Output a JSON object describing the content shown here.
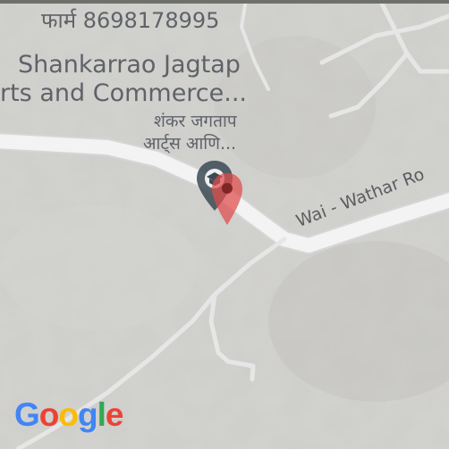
{
  "map": {
    "place_phone_label": "फार्म 8698178995",
    "place_name_en_line1": "Shankarrao Jagtap",
    "place_name_en_line2": "rts and Commerce...",
    "place_name_mr_line1": "शंकर जगताप",
    "place_name_mr_line2": "आर्ट्स आणि...",
    "road_label": "Wai - Wathar Ro",
    "logo_letters": [
      "G",
      "o",
      "o",
      "g",
      "l",
      "e"
    ],
    "logo_colors": [
      "#4285F4",
      "#EA4335",
      "#FBBC05",
      "#4285F4",
      "#34A853",
      "#EA4335"
    ],
    "marker_colors": {
      "place_pin": "#3c4a52",
      "selected_pin": "#e04b4b"
    },
    "icons": {
      "place_pin": "school-pin-icon",
      "selected_pin": "map-marker-icon"
    }
  }
}
